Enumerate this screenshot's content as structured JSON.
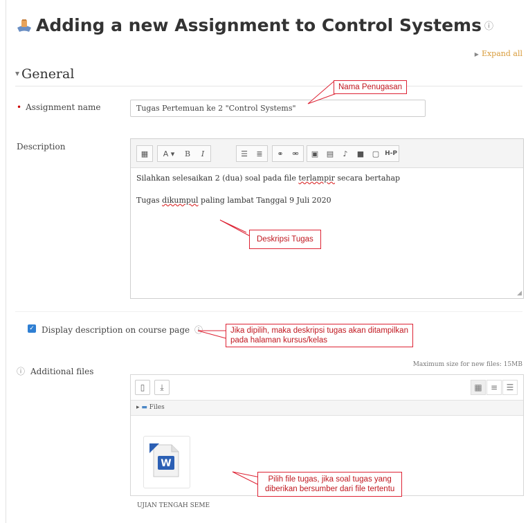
{
  "page": {
    "title": "Adding a new Assignment to Control Systems",
    "help_symbol": "ⓘ",
    "expand_all": "Expand all"
  },
  "general": {
    "heading": "General",
    "assignment_name_label": "Assignment name",
    "assignment_name_value": "Tugas Pertemuan ke 2 \"Control Systems\"",
    "description_label": "Description",
    "description_lines": {
      "line1_pre": "Silahkan selesaikan 2 (dua) soal pada file ",
      "line1_err": "terlampir",
      "line1_post": " secara bertahap",
      "line2_pre": "Tugas ",
      "line2_err": "dikumpul",
      "line2_post": " paling lambat Tanggal 9 Juli 2020"
    },
    "toolbar": {
      "font": "A ▾",
      "bold": "B",
      "italic": "I",
      "h5p": "H-P"
    },
    "display_description_label": "Display description on course page",
    "display_description_checked": true,
    "additional_files_label": "Additional files",
    "max_size": "Maximum size for new files: 15MB",
    "files_path": "Files",
    "file_name": "UJIAN TENGAH SEME"
  },
  "annotations": {
    "nama_penugasan": "Nama Penugasan",
    "deskripsi_tugas": "Deskripsi Tugas",
    "display_note_1": "Jika dipilih, maka deskripsi tugas akan ditampilkan",
    "display_note_2": "pada halaman kursus/kelas",
    "file_note_1": "Pilih file tugas, jika soal tugas yang",
    "file_note_2": "diberikan bersumber dari file tertentu"
  },
  "colors": {
    "accent": "#d89b3a",
    "required": "#cc0000",
    "annotation": "#c0171f",
    "checkbox": "#2f7fd3"
  }
}
